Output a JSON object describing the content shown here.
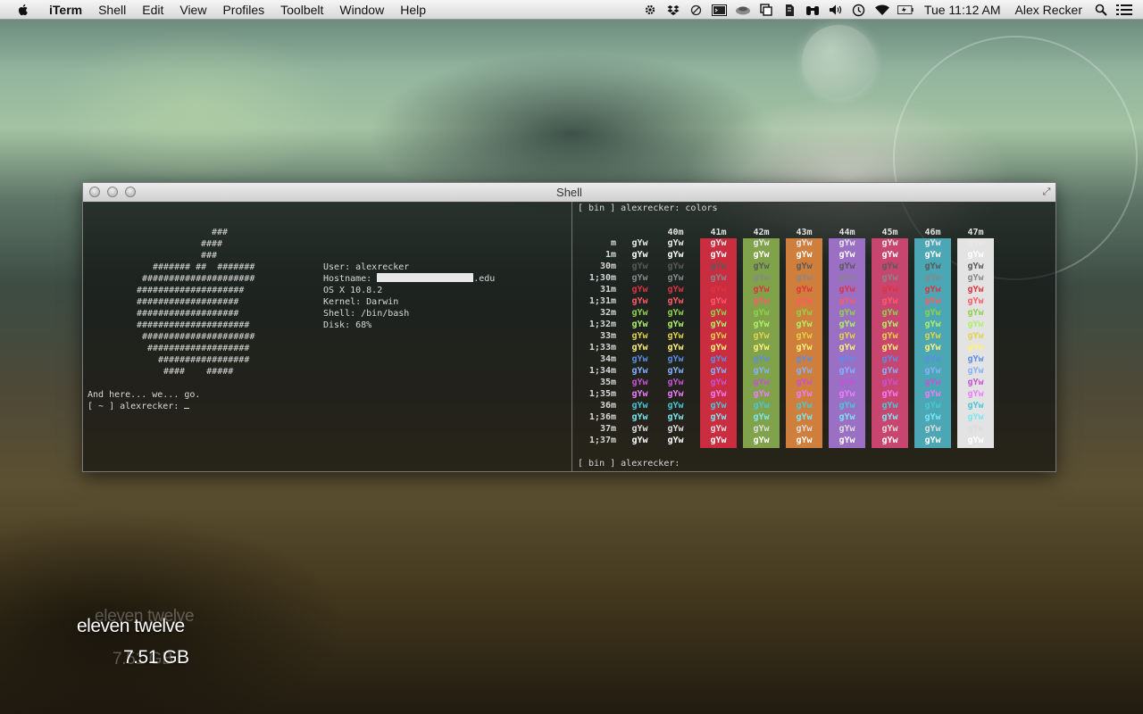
{
  "menubar": {
    "apple_icon": "apple-icon",
    "items": [
      "iTerm",
      "Shell",
      "Edit",
      "View",
      "Profiles",
      "Toolbelt",
      "Window",
      "Help"
    ],
    "status_icons": [
      "gear-icon",
      "dropbox-icon",
      "circle-slash-icon",
      "terminal-icon",
      "cloud-icon",
      "window-icon",
      "evernote-icon",
      "binoculars-icon",
      "volume-icon",
      "time-machine-icon",
      "wifi-icon",
      "battery-icon"
    ],
    "clock": "Tue 11:12 AM",
    "user": "Alex Recker",
    "right_icons": [
      "search-icon",
      "list-icon"
    ]
  },
  "window": {
    "title": "Shell"
  },
  "left_pane": {
    "ascii_art": [
      "###",
      "####",
      "###",
      "####### ##  #######",
      "#####################",
      "####################",
      "###################",
      "###################",
      "#####################",
      "#####################",
      "###################",
      "#################",
      "####    #####"
    ],
    "info": {
      "user": "User: alexrecker",
      "hostname_label": "Hostname: ",
      "hostname_suffix": ".edu",
      "os": "OS X 10.8.2",
      "kernel": "Kernel: Darwin",
      "shell": "Shell: /bin/bash",
      "disk": "Disk: 68%"
    },
    "line1": "And here... we... go.",
    "prompt": "[ ~ ] alexrecker: "
  },
  "right_pane": {
    "command": "[ bin ] alexrecker: colors",
    "prompt_end": "[ bin ] alexrecker:",
    "sample": "gYw",
    "headers": [
      "40m",
      "41m",
      "42m",
      "43m",
      "44m",
      "45m",
      "46m",
      "47m"
    ],
    "row_labels": [
      "m",
      "1m",
      "30m",
      "1;30m",
      "31m",
      "1;31m",
      "32m",
      "1;32m",
      "33m",
      "1;33m",
      "34m",
      "1;34m",
      "35m",
      "1;35m",
      "36m",
      "1;36m",
      "37m",
      "1;37m"
    ],
    "fg_colors": [
      "#e8e8e8",
      "#ffffff",
      "#5a5a5a",
      "#888888",
      "#e0333f",
      "#ff5a66",
      "#8fd14a",
      "#aef068",
      "#e2d24a",
      "#fff07a",
      "#5a8ee8",
      "#86b0ff",
      "#c852d8",
      "#ee7cff",
      "#4ac7d6",
      "#7ae6f2",
      "#dcdcdc",
      "#ffffff"
    ],
    "bg_colors": [
      "#c92d3f",
      "#7fa24a",
      "#cf7e3c",
      "#9a6fc4",
      "#c8456f",
      "#4aa7b3",
      "#e3e3e3"
    ]
  },
  "widget": {
    "name": "eleven twelve",
    "storage": "7.51 GB"
  }
}
